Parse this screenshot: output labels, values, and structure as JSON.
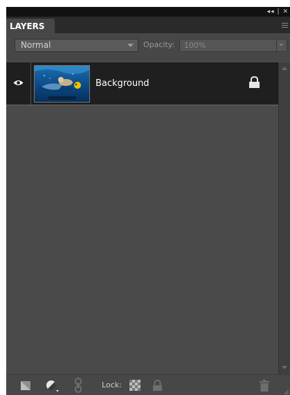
{
  "panel": {
    "tab_label": "LAYERS",
    "topbar_controls": "◂◂ | ✕"
  },
  "options": {
    "blend_mode": "Normal",
    "opacity_label": "Opacity:",
    "opacity_value": "100%"
  },
  "layers": [
    {
      "name": "Background",
      "visible": true,
      "locked": true
    }
  ],
  "bottom": {
    "lock_label": "Lock:"
  },
  "colors": {
    "panel_bg": "#4a4a4a",
    "selected_row": "#1f1f1f",
    "text": "#ffffff"
  }
}
